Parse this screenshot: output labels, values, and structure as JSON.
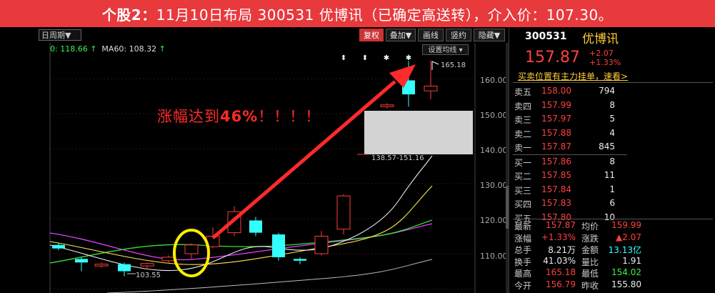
{
  "banner": {
    "prefix": "个股2：",
    "text": "11月10日布局 300531 优博讯（已确定高送转），介入价：107.30。"
  },
  "toolbar": {
    "period": "日周期▼",
    "buttons": [
      "复权",
      "叠加▼",
      "画线",
      "画线",
      "竖约",
      "隐藏▼"
    ],
    "active_index": 0,
    "settings_button": "设置均线"
  },
  "ma_legend": {
    "ma_prefix_value": "0: 118.66",
    "arrow": "↑",
    "ma60": "MA60: 108.32",
    "arrow2": "↑"
  },
  "annotation": {
    "text_a": "涨幅达到",
    "text_b": "46%",
    "text_c": "！！！！"
  },
  "chart_labels": {
    "high": "165.18",
    "low": "103.55",
    "range": "138.57-151.16"
  },
  "y_axis": [
    "160.00",
    "150.00",
    "140.00",
    "130.00",
    "120.00",
    "110.00"
  ],
  "colors": {
    "up": "#ff3b3b",
    "down": "#33ffff",
    "banner": "#e8393d",
    "accent": "#ffcc33"
  },
  "quote": {
    "code": "300531",
    "name": "优博讯",
    "price": "157.87",
    "change": "+2.07",
    "change_pct": "+1.33%",
    "link": "买卖位置有主力挂单，速看>"
  },
  "asks": [
    {
      "label": "卖五",
      "price": "158.00",
      "vol": "794"
    },
    {
      "label": "卖四",
      "price": "157.99",
      "vol": "8"
    },
    {
      "label": "卖三",
      "price": "157.97",
      "vol": "5"
    },
    {
      "label": "卖二",
      "price": "157.88",
      "vol": "4"
    },
    {
      "label": "卖一",
      "price": "157.87",
      "vol": "845"
    }
  ],
  "bids": [
    {
      "label": "买一",
      "price": "157.86",
      "vol": "8"
    },
    {
      "label": "买二",
      "price": "157.85",
      "vol": "11"
    },
    {
      "label": "买三",
      "price": "157.84",
      "vol": "1"
    },
    {
      "label": "买四",
      "price": "157.83",
      "vol": "6"
    },
    {
      "label": "买五",
      "price": "157.80",
      "vol": "10"
    }
  ],
  "stats": [
    {
      "k1": "最新",
      "v1": "157.87",
      "k2": "均价",
      "v2": "159.99"
    },
    {
      "k1": "涨幅",
      "v1": "+1.33%",
      "k2": "涨跌",
      "v2": "▲2.07"
    },
    {
      "k1": "总手",
      "v1": "8.21万",
      "k2": "金额",
      "v2": "13.13亿"
    },
    {
      "k1": "换手",
      "v1": "41.03%",
      "k2": "量比",
      "v2": "1.91"
    },
    {
      "k1": "最高",
      "v1": "165.18",
      "k2": "最低",
      "v2": "154.02"
    },
    {
      "k1": "今开",
      "v1": "156.79",
      "k2": "昨收",
      "v2": "155.80"
    }
  ],
  "chart_data": {
    "type": "candlestick",
    "y_range": [
      100,
      165
    ],
    "candles": [
      {
        "open": 112.5,
        "close": 111.5,
        "high": 113.0,
        "low": 111.0,
        "dir": "down"
      },
      {
        "open": 108.5,
        "close": 107.5,
        "high": 109.0,
        "low": 105.0,
        "dir": "down"
      },
      {
        "open": 106.5,
        "close": 107.0,
        "high": 107.5,
        "low": 106.0,
        "dir": "up"
      },
      {
        "open": 107.0,
        "close": 105.0,
        "high": 107.5,
        "low": 103.55,
        "dir": "down"
      },
      {
        "open": 106.5,
        "close": 107.2,
        "high": 107.5,
        "low": 105.5,
        "dir": "up"
      },
      {
        "open": 108.0,
        "close": 109.0,
        "high": 109.5,
        "low": 107.0,
        "dir": "up"
      },
      {
        "open": 110.0,
        "close": 112.5,
        "high": 113.0,
        "low": 108.5,
        "dir": "up"
      },
      {
        "open": 112.0,
        "close": 115.0,
        "high": 117.5,
        "low": 111.5,
        "dir": "up"
      },
      {
        "open": 116.0,
        "close": 122.0,
        "high": 123.5,
        "low": 115.0,
        "dir": "up"
      },
      {
        "open": 119.5,
        "close": 116.0,
        "high": 120.5,
        "low": 115.0,
        "dir": "down"
      },
      {
        "open": 115.5,
        "close": 109.0,
        "high": 116.0,
        "low": 108.0,
        "dir": "down"
      },
      {
        "open": 108.5,
        "close": 108.0,
        "high": 109.0,
        "low": 107.0,
        "dir": "down"
      },
      {
        "open": 110.0,
        "close": 115.0,
        "high": 116.5,
        "low": 109.5,
        "dir": "up"
      },
      {
        "open": 117.0,
        "close": 126.5,
        "high": 127.0,
        "low": 115.5,
        "dir": "up"
      },
      {
        "open": 138.57,
        "close": 151.16,
        "high": 152.0,
        "low": 138.57,
        "dir": "gap"
      },
      {
        "open": 152.0,
        "close": 152.5,
        "high": 153.0,
        "low": 151.5,
        "dir": "up"
      },
      {
        "open": 159.5,
        "close": 155.5,
        "high": 165.0,
        "low": 152.0,
        "dir": "down"
      },
      {
        "open": 156.5,
        "close": 157.87,
        "high": 165.18,
        "low": 154.02,
        "dir": "up"
      }
    ]
  }
}
